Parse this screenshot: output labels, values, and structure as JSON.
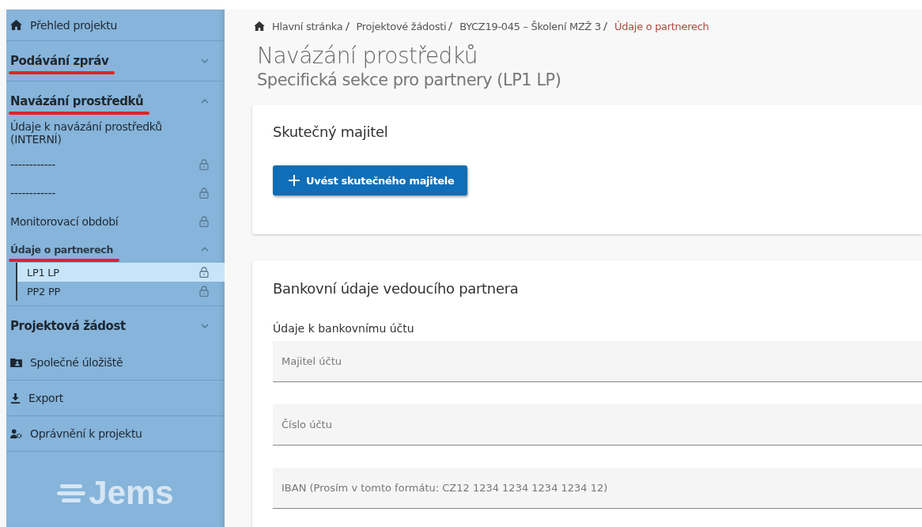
{
  "sidebar": {
    "items": [
      {
        "kind": "link",
        "label": "Přehled projektu"
      },
      {
        "kind": "section",
        "label": "Podávání zpráv",
        "expanded": false,
        "annotated": true
      },
      {
        "kind": "section",
        "label": "Navázání prostředků",
        "expanded": true,
        "annotated": true,
        "children": [
          {
            "kind": "item",
            "label": "Údaje k navázání prostředků (INTERNÍ)",
            "locked": false
          },
          {
            "kind": "item",
            "label": "------------",
            "locked": true
          },
          {
            "kind": "item",
            "label": "------------",
            "locked": true
          },
          {
            "kind": "item",
            "label": "Monitorovací období",
            "locked": true
          },
          {
            "kind": "group",
            "label": "Údaje o partnerech",
            "expanded": true,
            "annotated": true,
            "children": [
              {
                "label": "LP1 LP",
                "locked": true,
                "selected": true
              },
              {
                "label": "PP2 PP",
                "locked": true,
                "selected": false
              }
            ]
          }
        ]
      },
      {
        "kind": "section",
        "label": "Projektová žádost",
        "expanded": false,
        "annotated": false
      },
      {
        "kind": "link",
        "label": "Společné úložiště"
      },
      {
        "kind": "link",
        "label": "Export"
      },
      {
        "kind": "link",
        "label": "Oprávnění k projektu"
      }
    ],
    "logo": "Jems"
  },
  "breadcrumbs": [
    "Hlavní stránka",
    "Projektové žádosti",
    "BYCZ19-045 – Školení MZŽ 3",
    "Údaje o partnerech"
  ],
  "title": "Navázání prostředků",
  "subtitle": "Specifická sekce pro partnery (LP1 LP)",
  "owner_card": {
    "title": "Skutečný majitel",
    "button": "Uvést skutečného majitele"
  },
  "bank_card": {
    "title": "Bankovní údaje vedoucího partnera",
    "section_label": "Údaje k bankovnímu účtu",
    "fields": [
      {
        "placeholder": "Majitel účtu"
      },
      {
        "placeholder": "Číslo účtu"
      },
      {
        "placeholder": "IBAN (Prosím v tomto formátu: CZ12 1234 1234 1234 1234 12)"
      }
    ]
  }
}
